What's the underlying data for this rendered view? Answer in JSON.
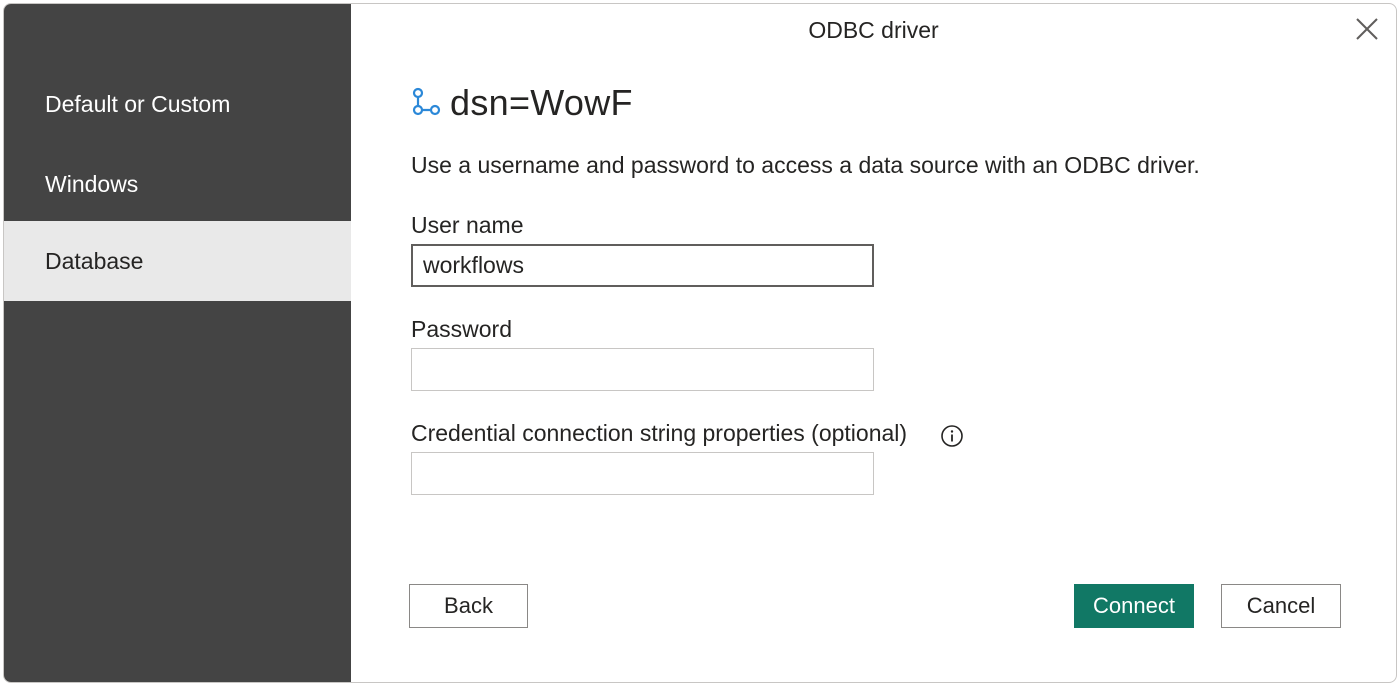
{
  "dialog": {
    "title": "ODBC driver",
    "close_icon": "close-icon"
  },
  "sidebar": {
    "items": [
      {
        "label": "Default or Custom",
        "selected": false
      },
      {
        "label": "Windows",
        "selected": false
      },
      {
        "label": "Database",
        "selected": true
      }
    ]
  },
  "main": {
    "source_icon": "data-source-icon",
    "source_name": "dsn=WowF",
    "description": "Use a username and password to access a data source with an ODBC driver.",
    "fields": {
      "username": {
        "label": "User name",
        "value": "workflows"
      },
      "password": {
        "label": "Password",
        "value": ""
      },
      "credential_props": {
        "label": "Credential connection string properties (optional)",
        "value": "",
        "info_icon": "info-icon"
      }
    }
  },
  "buttons": {
    "back": "Back",
    "connect": "Connect",
    "cancel": "Cancel"
  },
  "colors": {
    "sidebar_bg": "#444444",
    "selected_item_bg": "#e9e9e9",
    "primary": "#117865",
    "accent_icon": "#2b88d8"
  }
}
